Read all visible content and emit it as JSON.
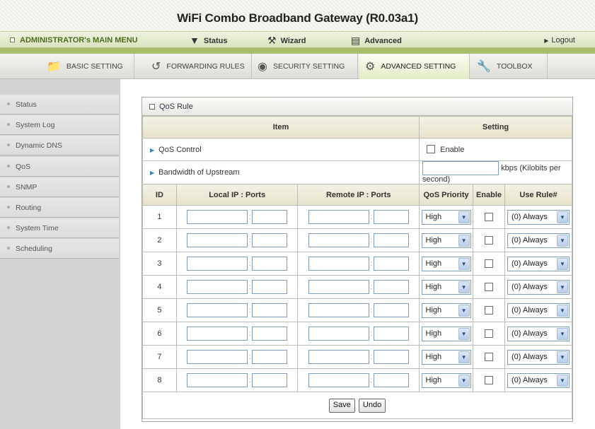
{
  "title": "WiFi Combo Broadband Gateway (R0.03a1)",
  "main_menu": {
    "admin_label": "ADMINISTRATOR's MAIN MENU",
    "items": [
      {
        "label": "Status",
        "icon": "status-icon"
      },
      {
        "label": "Wizard",
        "icon": "wizard-icon"
      },
      {
        "label": "Advanced",
        "icon": "advanced-icon"
      }
    ],
    "logout": "Logout"
  },
  "sub_tabs": [
    {
      "label": "BASIC SETTING",
      "icon": "folder-icon"
    },
    {
      "label": "FORWARDING RULES",
      "icon": "forwarding-icon"
    },
    {
      "label": "SECURITY SETTING",
      "icon": "security-icon"
    },
    {
      "label": "ADVANCED SETTING",
      "icon": "advanced-setting-icon",
      "active": true
    },
    {
      "label": "TOOLBOX",
      "icon": "toolbox-icon"
    }
  ],
  "sidebar": {
    "items": [
      "Status",
      "System Log",
      "Dynamic DNS",
      "QoS",
      "SNMP",
      "Routing",
      "System Time",
      "Scheduling"
    ]
  },
  "panel": {
    "title": "QoS Rule",
    "headers": {
      "item": "Item",
      "setting": "Setting"
    },
    "qos_control": {
      "label": "QoS Control",
      "enable_label": "Enable"
    },
    "bandwidth": {
      "label": "Bandwidth of Upstream",
      "value": "",
      "unit": "kbps (Kilobits per second)"
    },
    "columns": [
      "ID",
      "Local IP : Ports",
      "Remote IP : Ports",
      "QoS Priority",
      "Enable",
      "Use Rule#"
    ],
    "rows": [
      {
        "id": "1",
        "priority": "High",
        "rule": "(0) Always"
      },
      {
        "id": "2",
        "priority": "High",
        "rule": "(0) Always"
      },
      {
        "id": "3",
        "priority": "High",
        "rule": "(0) Always"
      },
      {
        "id": "4",
        "priority": "High",
        "rule": "(0) Always"
      },
      {
        "id": "5",
        "priority": "High",
        "rule": "(0) Always"
      },
      {
        "id": "6",
        "priority": "High",
        "rule": "(0) Always"
      },
      {
        "id": "7",
        "priority": "High",
        "rule": "(0) Always"
      },
      {
        "id": "8",
        "priority": "High",
        "rule": "(0) Always"
      }
    ],
    "buttons": {
      "save": "Save",
      "undo": "Undo"
    }
  },
  "colors": {
    "accent_green": "#a9bf6e",
    "header_text": "#4f6b1f",
    "input_border": "#7b9ebd"
  }
}
